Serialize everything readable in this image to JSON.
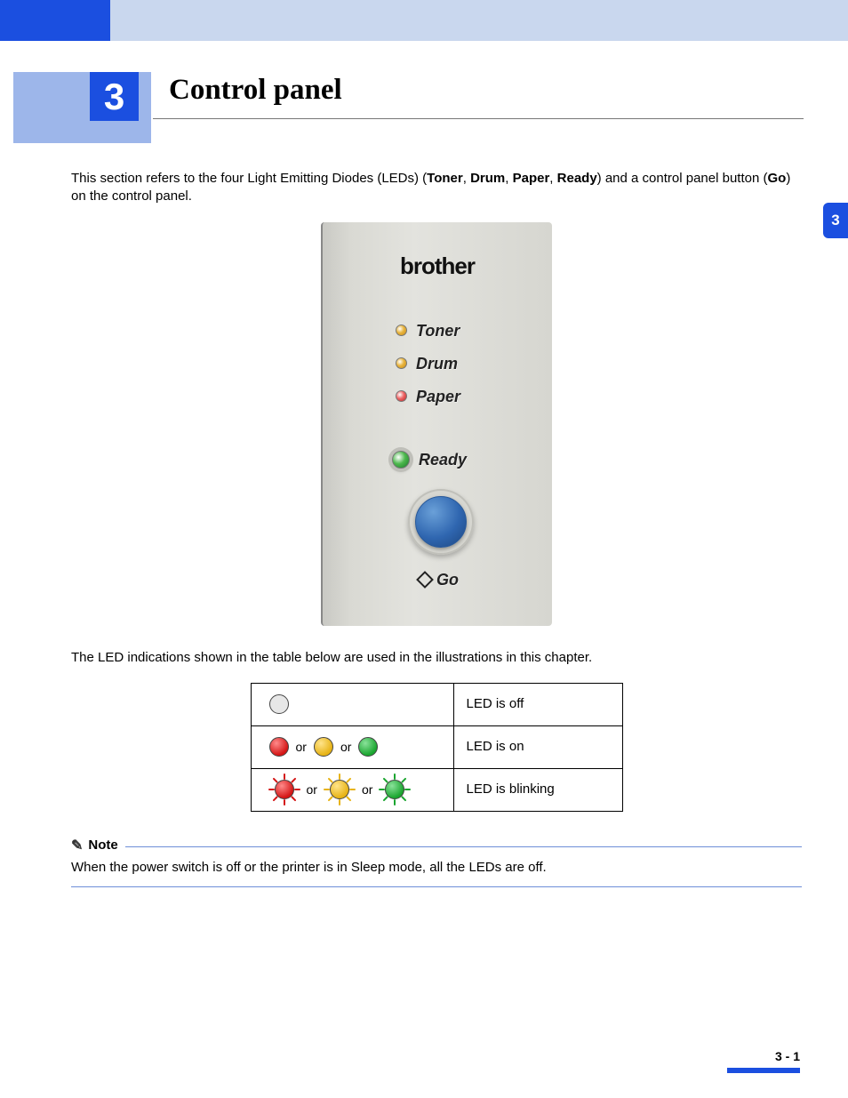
{
  "chapter": {
    "number": "3",
    "title": "Control panel"
  },
  "sideTab": "3",
  "intro": {
    "pre": "This section refers to the four Light Emitting Diodes (LEDs) (",
    "leds": [
      "Toner",
      "Drum",
      "Paper",
      "Ready"
    ],
    "sep": ", ",
    "mid": ") and a control panel button (",
    "button": "Go",
    "post": ") on the control panel."
  },
  "panel": {
    "logo": "brother",
    "labels": {
      "toner": "Toner",
      "drum": "Drum",
      "paper": "Paper",
      "ready": "Ready",
      "go": "Go"
    }
  },
  "tableIntro": "The LED indications shown in the table below are used in the illustrations in this chapter.",
  "ledTable": {
    "or": "or",
    "rows": [
      {
        "desc": "LED is off"
      },
      {
        "desc": "LED is on"
      },
      {
        "desc": "LED is blinking"
      }
    ]
  },
  "note": {
    "label": "Note",
    "text": "When the power switch is off or the printer is in Sleep mode, all the LEDs are off."
  },
  "footer": {
    "page": "3 - 1"
  }
}
